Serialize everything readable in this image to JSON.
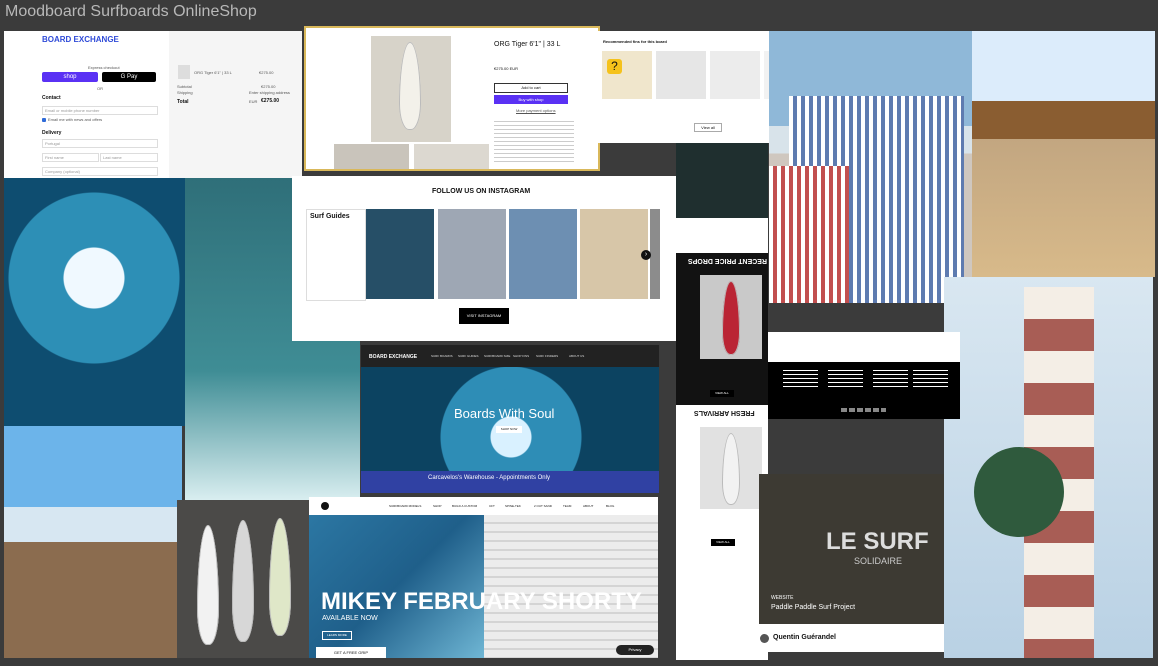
{
  "title": "Moodboard Surfboards OnlineShop",
  "checkout": {
    "brand": "BOARD EXCHANGE",
    "express": "Express checkout",
    "shop": "shop",
    "gpay": "G Pay",
    "or": "OR",
    "contact": "Contact",
    "email_placeholder": "Email or mobile phone number",
    "offers": "Email me with news and offers",
    "delivery": "Delivery",
    "country": "Portugal",
    "first": "First name",
    "last": "Last name",
    "company": "Company (optional)",
    "item": "ORG Tiger 6'1\" | 33 L",
    "item_price": "€275.00",
    "subtotal": "Subtotal",
    "subtotal_val": "€275.00",
    "shipping": "Shipping",
    "shipping_val": "Enter shipping address",
    "total": "Total",
    "total_cur": "EUR",
    "total_val": "€275.00"
  },
  "product": {
    "name": "ORG Tiger 6'1\" | 33 L",
    "price": "€275.00 EUR",
    "add": "Add to cart",
    "buy": "Buy with shop",
    "more": "More payment options"
  },
  "fins": {
    "heading": "Recommended fins for this board",
    "view_all": "View all"
  },
  "instagram": {
    "heading": "FOLLOW US ON INSTAGRAM",
    "guides": "Surf Guides",
    "button": "VISIT INSTAGRAM"
  },
  "web1": {
    "brand": "BOARD EXCHANGE",
    "hero": "Boards With Soul",
    "shop": "SHOP NOW",
    "banner": "Carcavelos's Warehouse - Appointments Only",
    "nav": [
      "SURF BOARDS",
      "SURF GUIDES",
      "SURFBOARD SIZE",
      "SHOP FINS",
      "SURF FINDERS",
      "ABOUT US"
    ]
  },
  "web2": {
    "nav": [
      "SURFBOARD MODELS",
      "SHOP",
      "BUILD A CUSTOM",
      "CFT",
      "SPINE-TEK",
      "2 OUT SAND",
      "TEAM",
      "ABOUT",
      "BLOG"
    ],
    "headline": "MIKEY FEBRUARY SHORTY",
    "sub": "AVAILABLE NOW",
    "learn": "LEARN MORE",
    "grip": "GET A FREE GRIP",
    "chat": "Privacy"
  },
  "mobile": {
    "drops": "RECENT PRICE DROPS",
    "arrivals": "FRESH ARRIVALS",
    "view": "VIEW ALL"
  },
  "lesurf": {
    "big": "LE SURF",
    "small": "SOLIDAIRE",
    "website": "WEBSITE",
    "project": "Paddle Paddle Surf Project",
    "author": "Quentin Guérandel"
  }
}
